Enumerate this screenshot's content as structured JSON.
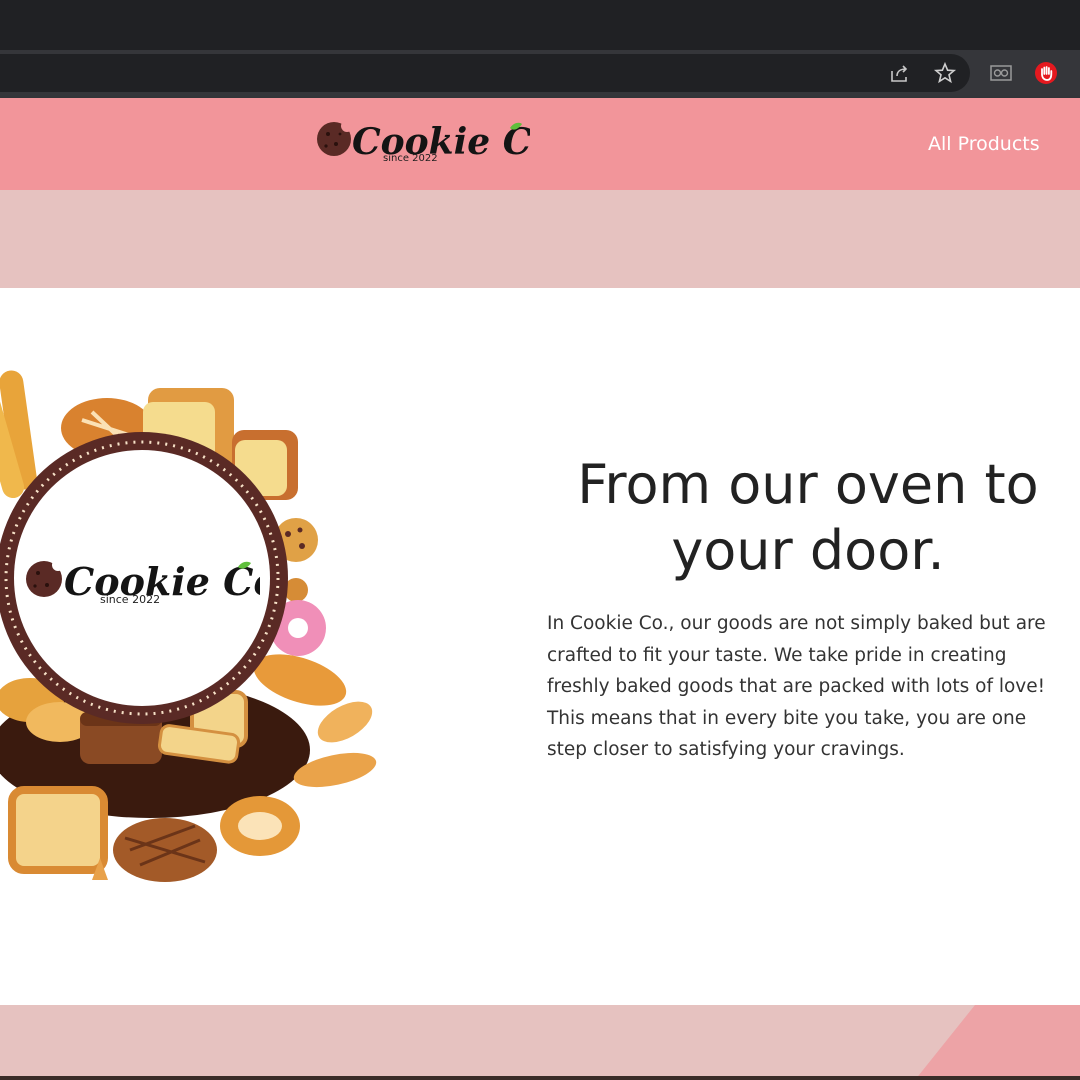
{
  "browser": {
    "icons": [
      "share-icon",
      "star-icon",
      "reading-mode-icon",
      "extension-stop-icon"
    ],
    "extension_color": "#e5191f"
  },
  "header": {
    "brand": "Cookie Co.",
    "tagline": "since 2022",
    "nav_link": "All Products",
    "background": "#f2959a"
  },
  "hero": {
    "emblem_brand": "Cookie Co.",
    "emblem_tagline": "since 2022",
    "title_line1": "From our oven to",
    "title_line2": "your door.",
    "body": "In Cookie Co., our goods are not simply baked but are crafted to fit your taste. We take pride in creating freshly baked goods that are packed with lots of love! This means that in every bite you take, you are one step closer to satisfying your cravings."
  },
  "colors": {
    "band": "#e6c2c0",
    "accent_pink": "#eda3a6",
    "brand_brown": "#5a2a25"
  }
}
